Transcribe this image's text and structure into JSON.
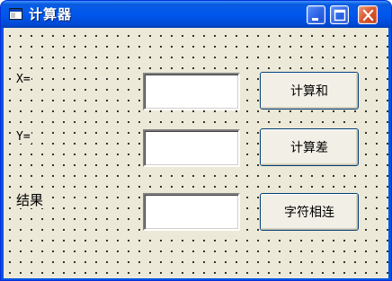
{
  "window": {
    "title": "计算器",
    "controls": {
      "minimize": "minimize-icon",
      "maximize": "maximize-icon",
      "close": "close-icon"
    }
  },
  "form": {
    "x_label": "X=",
    "y_label": "Y=",
    "result_label": "结果",
    "x_input": {
      "value": ""
    },
    "y_input": {
      "value": ""
    },
    "result_input": {
      "value": ""
    },
    "buttons": {
      "sum": "计算和",
      "difference": "计算差",
      "concat": "字符相连"
    }
  },
  "colors": {
    "titlebar": "#0058ee",
    "form_background": "#ece9d8",
    "close_button": "#d9542b"
  }
}
